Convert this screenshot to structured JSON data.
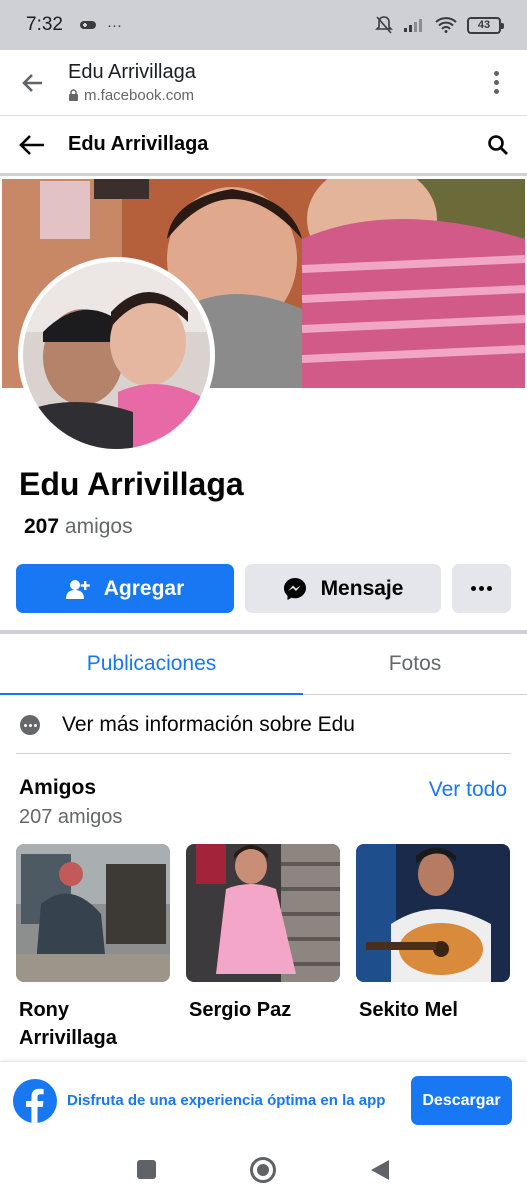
{
  "status_bar": {
    "time": "7:32",
    "extra": "···",
    "battery": "43"
  },
  "browser": {
    "title": "Edu Arrivillaga",
    "url": "m.facebook.com"
  },
  "header": {
    "title": "Edu Arrivillaga"
  },
  "profile": {
    "name": "Edu Arrivillaga",
    "friends_count": "207",
    "friends_word": "amigos"
  },
  "actions": {
    "add_label": "Agregar",
    "message_label": "Mensaje"
  },
  "tabs": [
    {
      "label": "Publicaciones",
      "active": true
    },
    {
      "label": "Fotos",
      "active": false
    }
  ],
  "info": {
    "text": "Ver más información sobre Edu"
  },
  "friends": {
    "title": "Amigos",
    "subtitle": "207 amigos",
    "see_all": "Ver todo",
    "list": [
      {
        "name": "Rony Arrivillaga"
      },
      {
        "name": "Sergio Paz"
      },
      {
        "name": "Sekito Mel"
      }
    ]
  },
  "banner": {
    "text": "Disfruta de una experiencia óptima en la app",
    "button": "Descargar"
  },
  "colors": {
    "accent": "#1877f2",
    "secondary_button": "#e4e6eb",
    "muted_text": "#65676b"
  }
}
